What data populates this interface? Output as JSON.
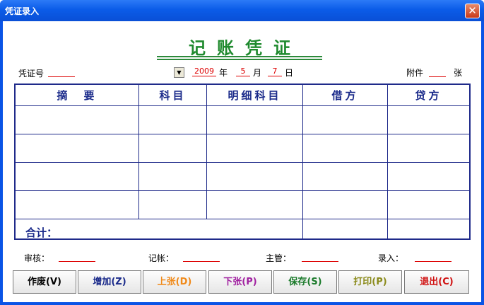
{
  "window": {
    "title": "凭证录入",
    "close": "✕"
  },
  "heading": "记账凭证",
  "voucher_no": {
    "label": "凭证号",
    "value": ""
  },
  "date": {
    "year": "2009",
    "year_unit": "年",
    "month": "5",
    "month_unit": "月",
    "day": "7",
    "day_unit": "日",
    "dropdown": "▼"
  },
  "attachment": {
    "label": "附件",
    "value": "",
    "unit": "张"
  },
  "table": {
    "headers": [
      "摘　要",
      "科目",
      "明细科目",
      "借方",
      "贷方"
    ],
    "total_label": "合计："
  },
  "signatures": [
    {
      "label": "审核：",
      "value": ""
    },
    {
      "label": "记帐：",
      "value": ""
    },
    {
      "label": "主管：",
      "value": ""
    },
    {
      "label": "录入：",
      "value": ""
    }
  ],
  "buttons": [
    {
      "label": "作废(V)",
      "color": "#000000"
    },
    {
      "label": "增加(Z)",
      "color": "#1a2a8a"
    },
    {
      "label": "上张(D)",
      "color": "#f08a1a"
    },
    {
      "label": "下张(P)",
      "color": "#a020a0"
    },
    {
      "label": "保存(S)",
      "color": "#1a7a2a"
    },
    {
      "label": "打印(P)",
      "color": "#8a8a1a"
    },
    {
      "label": "退出(C)",
      "color": "#d01010"
    }
  ]
}
